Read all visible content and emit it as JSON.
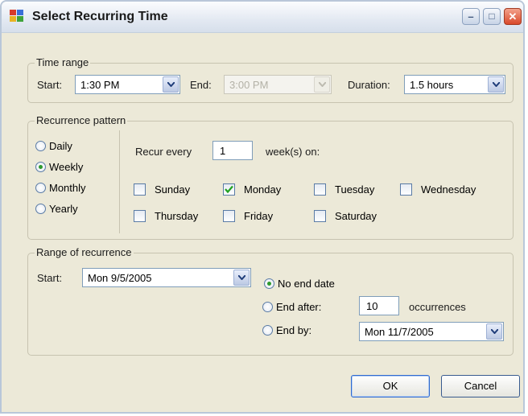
{
  "window": {
    "title": "Select Recurring Time",
    "buttons": {
      "minimize": "–",
      "maximize": "□",
      "close": "✕"
    }
  },
  "time_range": {
    "legend": "Time range",
    "start_label": "Start:",
    "start_value": "1:30 PM",
    "end_label": "End:",
    "end_value": "3:00 PM",
    "duration_label": "Duration:",
    "duration_value": "1.5 hours"
  },
  "recurrence_pattern": {
    "legend": "Recurrence pattern",
    "options": [
      {
        "label": "Daily",
        "selected": false
      },
      {
        "label": "Weekly",
        "selected": true
      },
      {
        "label": "Monthly",
        "selected": false
      },
      {
        "label": "Yearly",
        "selected": false
      }
    ],
    "recur_every_label": "Recur every",
    "recur_every_value": "1",
    "weeks_on_label": "week(s) on:",
    "days": [
      {
        "label": "Sunday",
        "checked": false
      },
      {
        "label": "Monday",
        "checked": true
      },
      {
        "label": "Tuesday",
        "checked": false
      },
      {
        "label": "Wednesday",
        "checked": false
      },
      {
        "label": "Thursday",
        "checked": false
      },
      {
        "label": "Friday",
        "checked": false
      },
      {
        "label": "Saturday",
        "checked": false
      }
    ]
  },
  "range_of_recurrence": {
    "legend": "Range of recurrence",
    "start_label": "Start:",
    "start_value": "Mon 9/5/2005",
    "end_options": [
      {
        "label": "No end date",
        "selected": true
      },
      {
        "label": "End after:",
        "selected": false
      },
      {
        "label": "End by:",
        "selected": false
      }
    ],
    "occurrences_value": "10",
    "occurrences_label": "occurrences",
    "end_by_value": "Mon 11/7/2005"
  },
  "footer": {
    "ok_label": "OK",
    "cancel_label": "Cancel"
  }
}
